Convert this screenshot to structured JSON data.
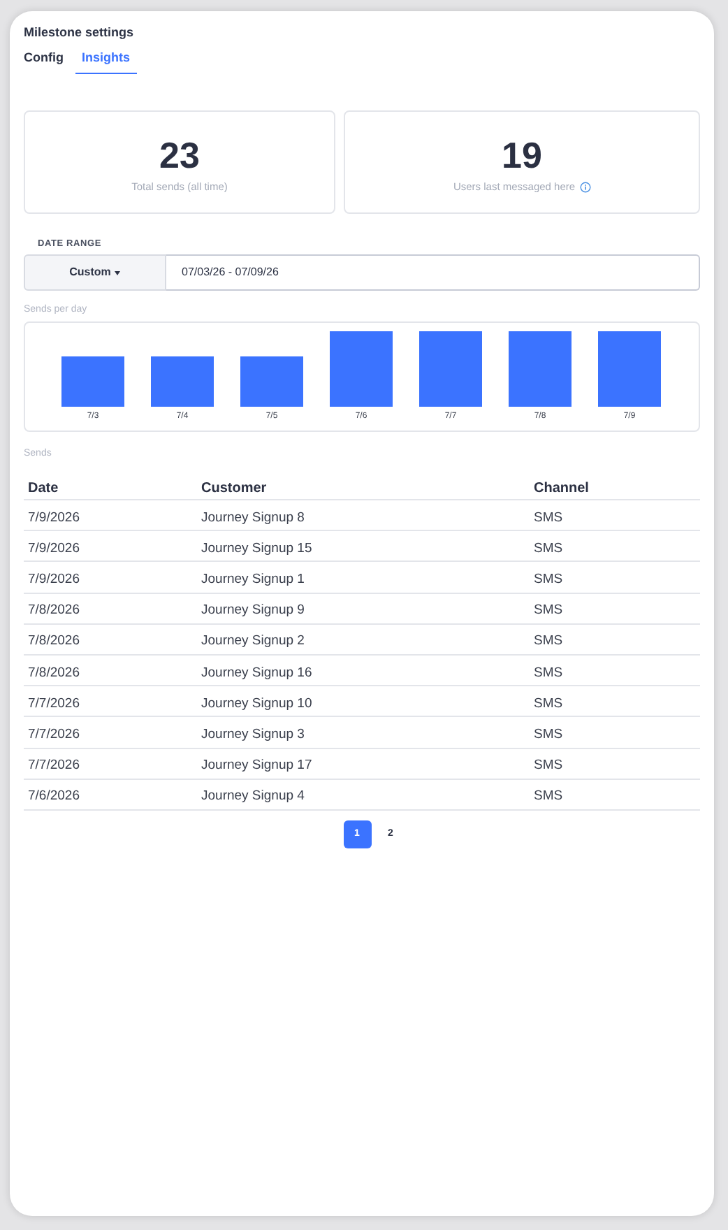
{
  "title": "Milestone settings",
  "tabs": [
    {
      "label": "Config",
      "selected": false
    },
    {
      "label": "Insights",
      "selected": true
    }
  ],
  "stats": [
    {
      "value": "23",
      "label": "Total sends (all time)",
      "info": false
    },
    {
      "value": "19",
      "label": "Users last messaged here",
      "info": true
    }
  ],
  "date_range": {
    "label": "DATE RANGE",
    "preset": "Custom",
    "value": "07/03/26 - 07/09/26"
  },
  "sends_per_day": {
    "title": "Sends per day",
    "bars": [
      {
        "label": "7/3",
        "kind": "short"
      },
      {
        "label": "7/4",
        "kind": "short"
      },
      {
        "label": "7/5",
        "kind": "short"
      },
      {
        "label": "7/6",
        "kind": "tall"
      },
      {
        "label": "7/7",
        "kind": "tall"
      },
      {
        "label": "7/8",
        "kind": "tall"
      },
      {
        "label": "7/9",
        "kind": "tall"
      }
    ]
  },
  "sends": {
    "title": "Sends",
    "columns": [
      "Date",
      "Customer",
      "Channel"
    ],
    "rows": [
      [
        "7/9/2026",
        "Journey Signup 8",
        "SMS"
      ],
      [
        "7/9/2026",
        "Journey Signup 15",
        "SMS"
      ],
      [
        "7/9/2026",
        "Journey Signup 1",
        "SMS"
      ],
      [
        "7/8/2026",
        "Journey Signup 9",
        "SMS"
      ],
      [
        "7/8/2026",
        "Journey Signup 2",
        "SMS"
      ],
      [
        "7/8/2026",
        "Journey Signup 16",
        "SMS"
      ],
      [
        "7/7/2026",
        "Journey Signup 10",
        "SMS"
      ],
      [
        "7/7/2026",
        "Journey Signup 3",
        "SMS"
      ],
      [
        "7/7/2026",
        "Journey Signup 17",
        "SMS"
      ],
      [
        "7/6/2026",
        "Journey Signup 4",
        "SMS"
      ]
    ]
  },
  "pagination": [
    {
      "label": "1",
      "selected": true
    },
    {
      "label": "2",
      "selected": false
    }
  ]
}
